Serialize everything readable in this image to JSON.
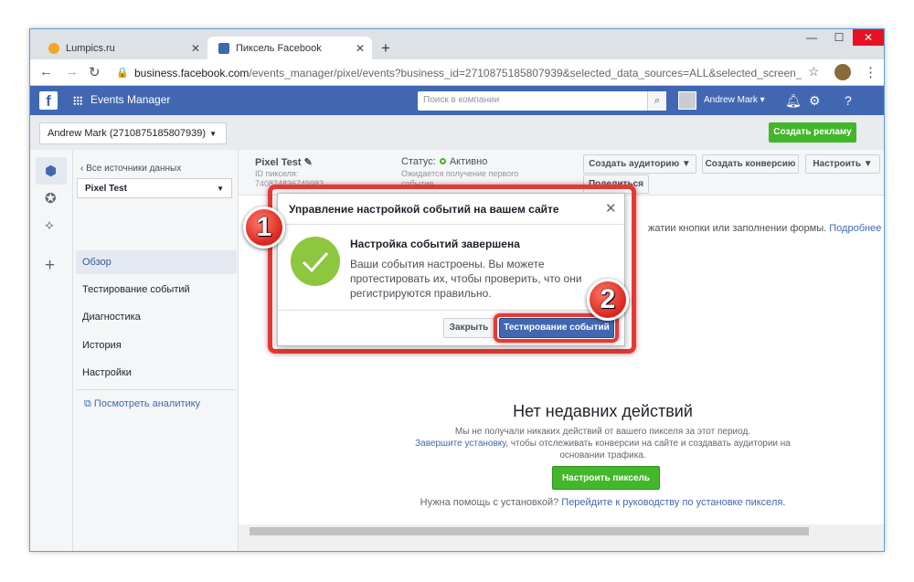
{
  "browser": {
    "tabs": [
      {
        "title": "Lumpics.ru",
        "favicon_color": "#f5a623"
      },
      {
        "title": "Пиксель Facebook",
        "favicon_color": "#4267b2"
      }
    ],
    "new_tab": "+",
    "url_host": "business.facebook.com",
    "url_path": "/events_manager/pixel/events?business_id=2710875185807939&selected_data_sources=ALL&selected_screen_section=DATA_SO...",
    "win_min": "—",
    "win_max": "☐",
    "win_close": "✕"
  },
  "fb": {
    "logo": "f",
    "app_title": "Events Manager",
    "search_placeholder": "Поиск в компании",
    "user_name": "Andrew Mark"
  },
  "subheader": {
    "account": "Andrew Mark (2710875185807939)",
    "create_ad": "Создать рекламу"
  },
  "sidebar": {
    "back": "Все источники данных",
    "source": "Pixel Test",
    "items": [
      {
        "label": "Обзор",
        "active": true
      },
      {
        "label": "Тестирование событий"
      },
      {
        "label": "Диагностика"
      },
      {
        "label": "История"
      },
      {
        "label": "Настройки"
      }
    ],
    "analytics": "Посмотреть аналитику"
  },
  "pixel": {
    "name": "Pixel Test",
    "id_label": "ID пикселя:",
    "id_value": "740874836749983",
    "status_label": "Статус:",
    "status_value": "Активно",
    "status_sub": "Ожидается получение первого события"
  },
  "actions": {
    "audience": "Создать аудиторию",
    "conversion": "Создать конверсию",
    "configure": "Настроить",
    "share": "Поделиться"
  },
  "main": {
    "hint_text": "жатии кнопки или заполнении формы.",
    "hint_link": "Подробнее",
    "empty_title": "Нет недавних действий",
    "empty_line1": "Мы не получали никаких действий от вашего пикселя за этот период.",
    "empty_link": "Завершите установку",
    "empty_line2": ", чтобы отслеживать конверсии на сайте и создавать аудитории на",
    "empty_line3": "основании трафика.",
    "setup_btn": "Настроить пиксель",
    "help_text": "Нужна помощь с установкой?",
    "help_link": "Перейдите к руководству по установке пикселя."
  },
  "modal": {
    "title": "Управление настройкой событий на вашем сайте",
    "heading": "Настройка событий завершена",
    "text": "Ваши события настроены. Вы можете протестировать их, чтобы проверить, что они регистрируются правильно.",
    "close_btn": "Закрыть",
    "test_btn": "Тестирование событий"
  },
  "badges": {
    "first": "1",
    "second": "2"
  },
  "colors": {
    "fb_blue": "#4267b2",
    "green": "#42b72a",
    "highlight": "#e53935"
  }
}
